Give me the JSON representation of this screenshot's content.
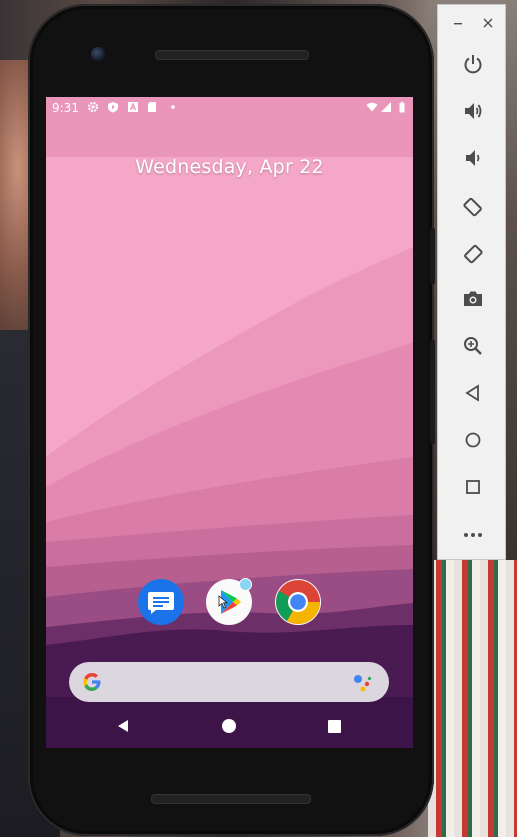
{
  "status_bar": {
    "time": "9:31",
    "icons": [
      "settings-icon",
      "play-protect-icon",
      "font-icon",
      "sd-card-icon",
      "dot-icon",
      "wifi-icon",
      "signal-icon",
      "battery-icon"
    ]
  },
  "home": {
    "date": "Wednesday, Apr 22",
    "dock_apps": [
      "Messages",
      "Play Store",
      "Chrome"
    ],
    "search_bar": {
      "icons": [
        "google-g-icon",
        "assistant-icon"
      ]
    }
  },
  "nav_bar": {
    "buttons": [
      "back",
      "home",
      "recents"
    ]
  },
  "emulator_toolbar": {
    "buttons": [
      "minimize",
      "close",
      "power",
      "volume-up",
      "volume-down",
      "rotate-left",
      "rotate-right",
      "screenshot",
      "zoom",
      "back",
      "home",
      "overview",
      "more"
    ]
  },
  "colors": {
    "wallpaper_top": "#f4a7c7",
    "wallpaper_bottom": "#3d1448",
    "search_bar": "#dcd6de",
    "emulator_panel": "#f1f1f1",
    "icon_gray": "#4d4d4d"
  }
}
